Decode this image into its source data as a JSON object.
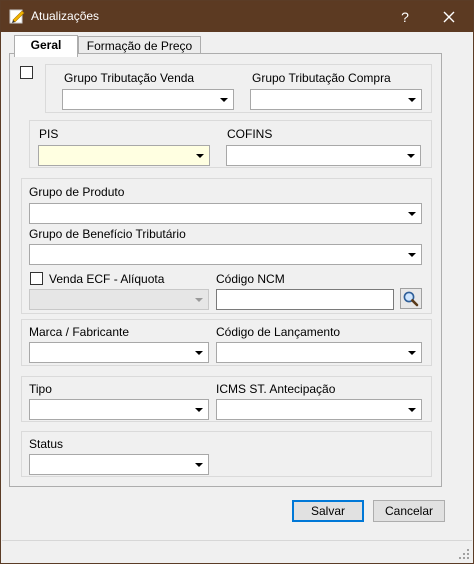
{
  "window": {
    "title": "Atualizações",
    "help_label": "?"
  },
  "tabs": [
    {
      "label": "Geral",
      "active": true
    },
    {
      "label": "Formação de Preço",
      "active": false
    }
  ],
  "tributacao": {
    "venda_label": "Grupo Tributação Venda",
    "venda_value": "",
    "compra_label": "Grupo Tributação Compra",
    "compra_value": ""
  },
  "impostos": {
    "pis_label": "PIS",
    "pis_value": "",
    "cofins_label": "COFINS",
    "cofins_value": ""
  },
  "produto": {
    "grupo_produto_label": "Grupo de Produto",
    "grupo_produto_value": "",
    "beneficio_label": "Grupo de Benefício Tributário",
    "beneficio_value": "",
    "venda_ecf_label": "Venda ECF - Alíquota",
    "venda_ecf_value": "",
    "ncm_label": "Código NCM",
    "ncm_value": ""
  },
  "marca": {
    "marca_label": "Marca / Fabricante",
    "marca_value": "",
    "lancamento_label": "Código de Lançamento",
    "lancamento_value": ""
  },
  "tipo": {
    "tipo_label": "Tipo",
    "tipo_value": "",
    "icms_label": "ICMS ST. Antecipação",
    "icms_value": ""
  },
  "status": {
    "label": "Status",
    "value": ""
  },
  "buttons": {
    "save": "Salvar",
    "cancel": "Cancelar"
  },
  "colors": {
    "titlebar": "#5c3a22",
    "accent": "#0078d7",
    "required_field": "#ffffe1"
  },
  "icons": [
    "edit-document-icon",
    "help-icon",
    "close-icon",
    "search-icon",
    "dropdown-arrow-icon",
    "resize-grip-icon"
  ]
}
